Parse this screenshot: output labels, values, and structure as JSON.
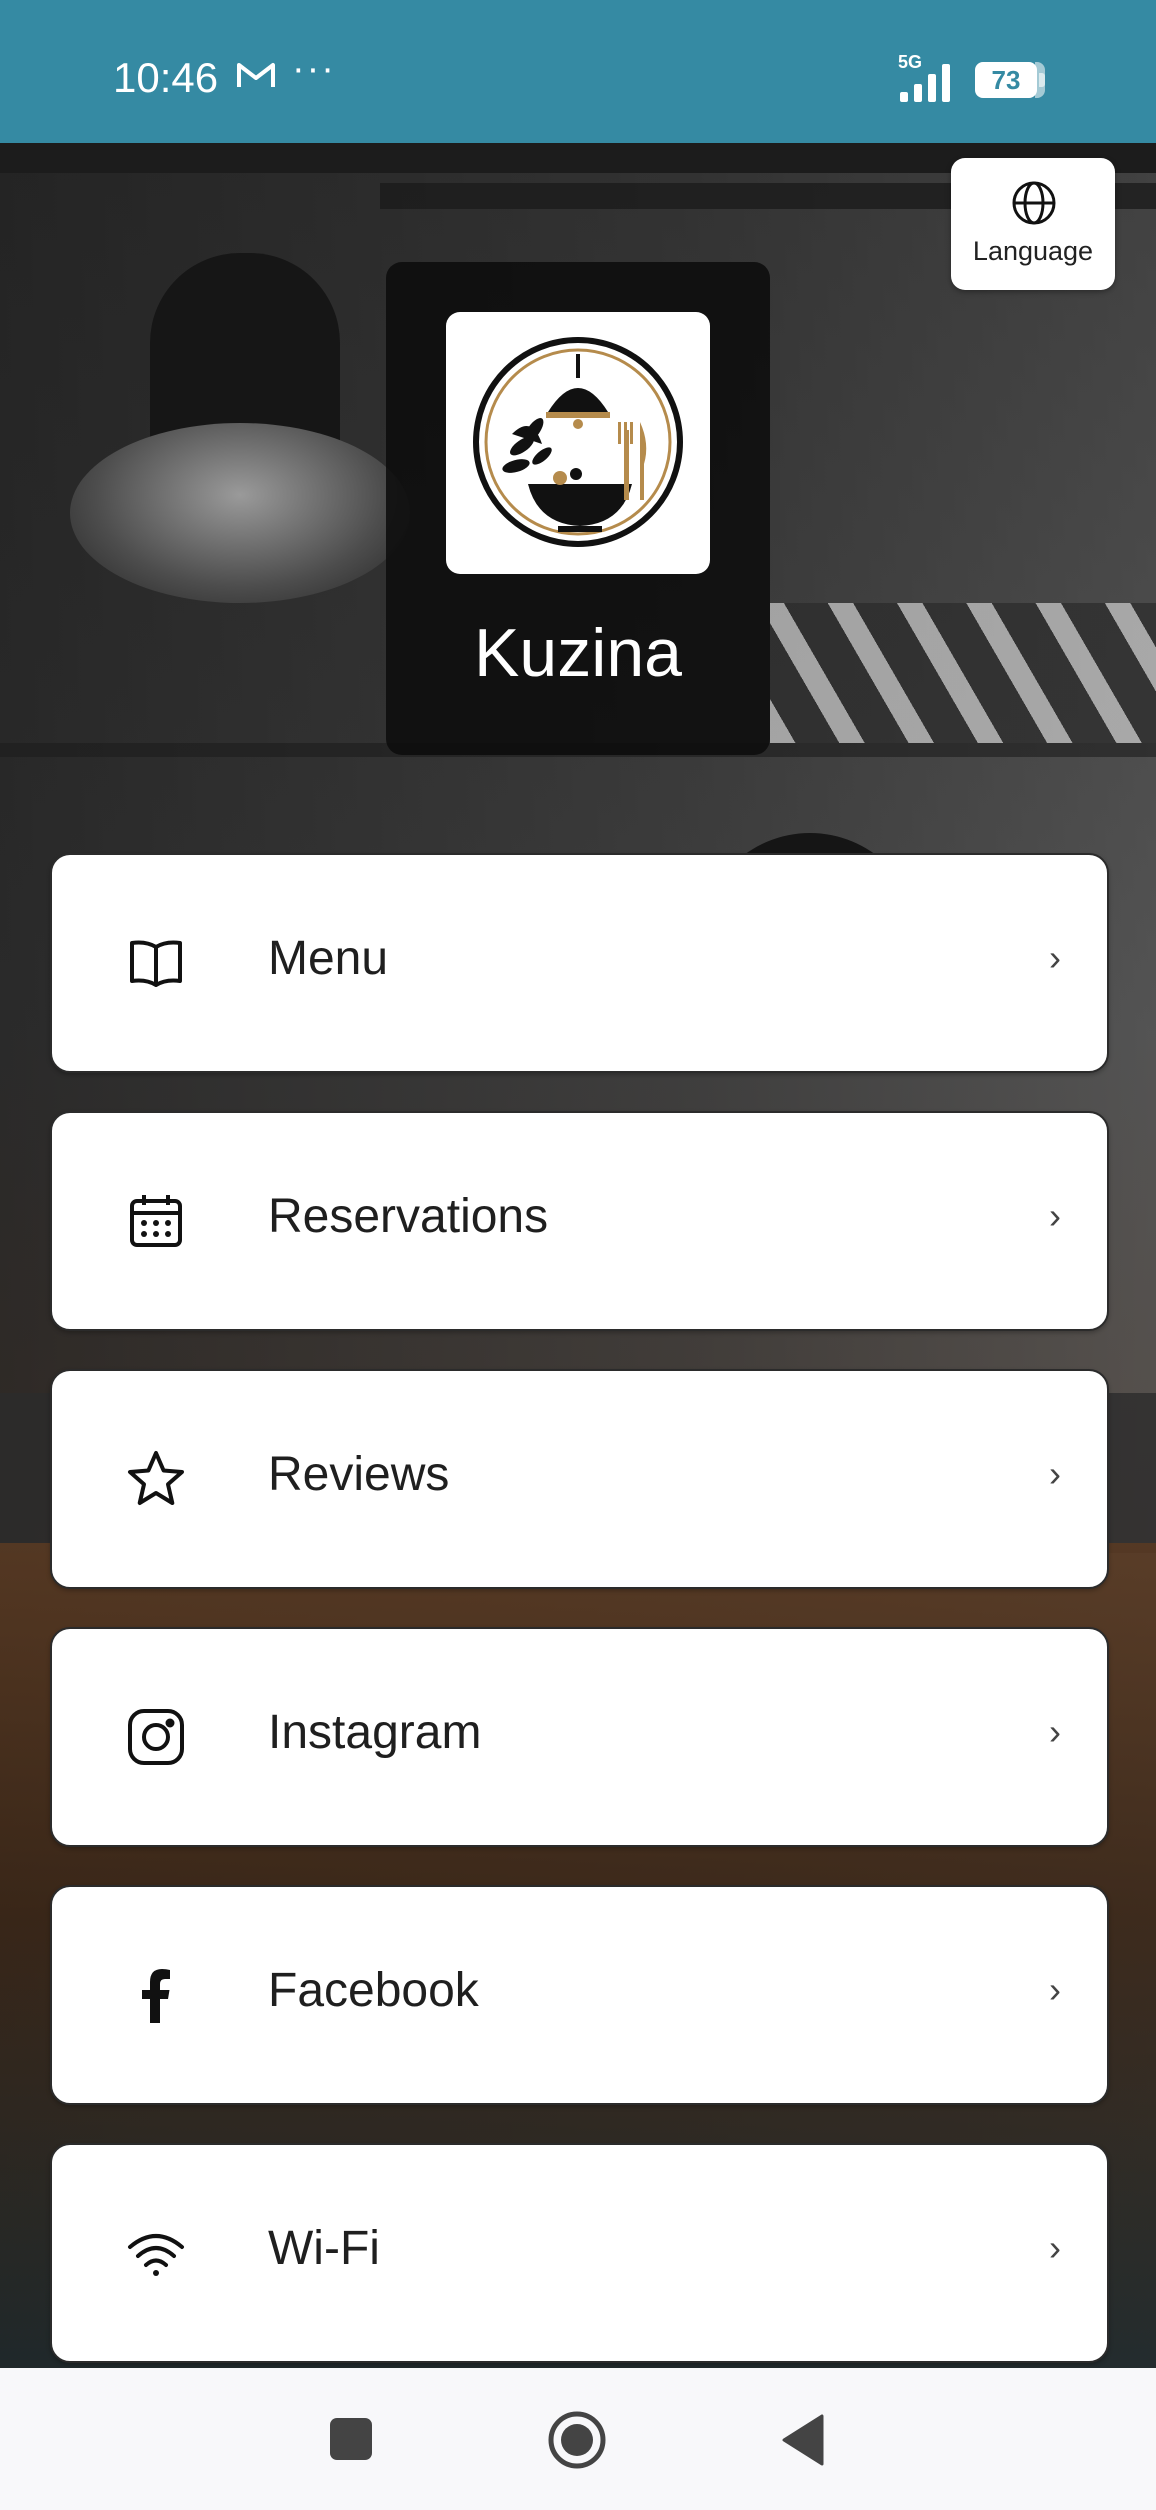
{
  "status_bar": {
    "time": "10:46",
    "network": "5G",
    "battery": "73",
    "icons": [
      "gmail-icon",
      "more-dots-icon",
      "signal-icon",
      "battery-icon"
    ]
  },
  "language_button": {
    "label": "Language",
    "icon": "globe-icon"
  },
  "brand": {
    "name": "Kuzina",
    "logo": "restaurant-logo-icon"
  },
  "links": [
    {
      "label": "Menu",
      "icon": "book-icon",
      "chevron": "›"
    },
    {
      "label": "Reservations",
      "icon": "calendar-icon",
      "chevron": "›"
    },
    {
      "label": "Reviews",
      "icon": "star-icon",
      "chevron": "›"
    },
    {
      "label": "Instagram",
      "icon": "instagram-icon",
      "chevron": "›"
    },
    {
      "label": "Facebook",
      "icon": "facebook-icon",
      "chevron": "›"
    },
    {
      "label": "Wi-Fi",
      "icon": "wifi-icon",
      "chevron": "›"
    }
  ],
  "nav_bar": {
    "items": [
      "recents-button",
      "home-button",
      "back-button"
    ]
  },
  "colors": {
    "status_bar": "#358aa3",
    "card_bg": "#0c0c0c",
    "button_bg": "#ffffff",
    "text": "#1f1f1f"
  }
}
